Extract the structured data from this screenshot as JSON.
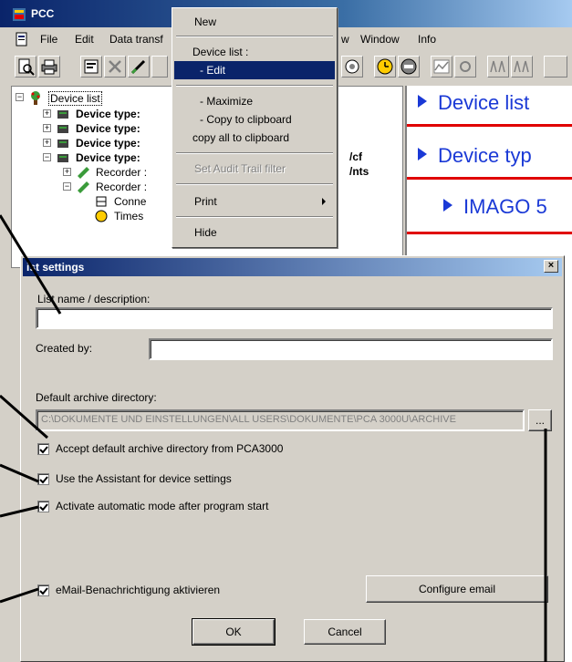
{
  "app": {
    "title": "PCC",
    "menus": [
      "File",
      "Edit",
      "Data transf",
      "w",
      "Window",
      "Info"
    ]
  },
  "tree": {
    "root_label": "Device list",
    "rows": [
      {
        "label": "Device type:",
        "bold": true
      },
      {
        "label": "Device type:",
        "bold": true
      },
      {
        "label": "Device type:",
        "bold": true
      },
      {
        "label": "Device type:",
        "bold": true
      },
      {
        "label": "Recorder :",
        "bold": false
      },
      {
        "label": "Recorder :",
        "bold": false
      },
      {
        "label": "Conne",
        "bold": false
      },
      {
        "label": "Times",
        "bold": false
      }
    ],
    "suffix_cf": "/cf",
    "suffix_nts": "/nts"
  },
  "doc": {
    "headings": [
      "Device list",
      "Device typ",
      "IMAGO 5"
    ],
    "accent_color": "#1a39d6",
    "rule_color": "#e00000"
  },
  "context_menu": {
    "new": "New",
    "device_list": "Device list :",
    "edit": "- Edit",
    "maximize": "- Maximize",
    "copy_to_clipboard": "- Copy to clipboard",
    "copy_all": "copy all to clipboard",
    "audit_filter": "Set Audit Trail filter",
    "print": "Print",
    "hide": "Hide"
  },
  "dialog": {
    "title": "List settings",
    "title_visible": "ist settings",
    "list_name_label": "List name / description:",
    "list_name_value": "",
    "created_by_label": "Created by:",
    "created_by_value": "",
    "archive_label": "Default archive directory:",
    "archive_value": "C:\\DOKUMENTE UND EINSTELLUNGEN\\ALL USERS\\DOKUMENTE\\PCA 3000U\\ARCHIVE",
    "browse_label": "...",
    "accept_default": "Accept default archive directory from PCA3000",
    "use_assistant": "Use the Assistant for device settings",
    "auto_mode": "Activate automatic mode after program start",
    "email_notify": "eMail-Benachrichtigung aktivieren",
    "configure_email": "Configure email",
    "ok": "OK",
    "cancel": "Cancel",
    "checked": [
      true,
      true,
      true,
      true
    ]
  }
}
